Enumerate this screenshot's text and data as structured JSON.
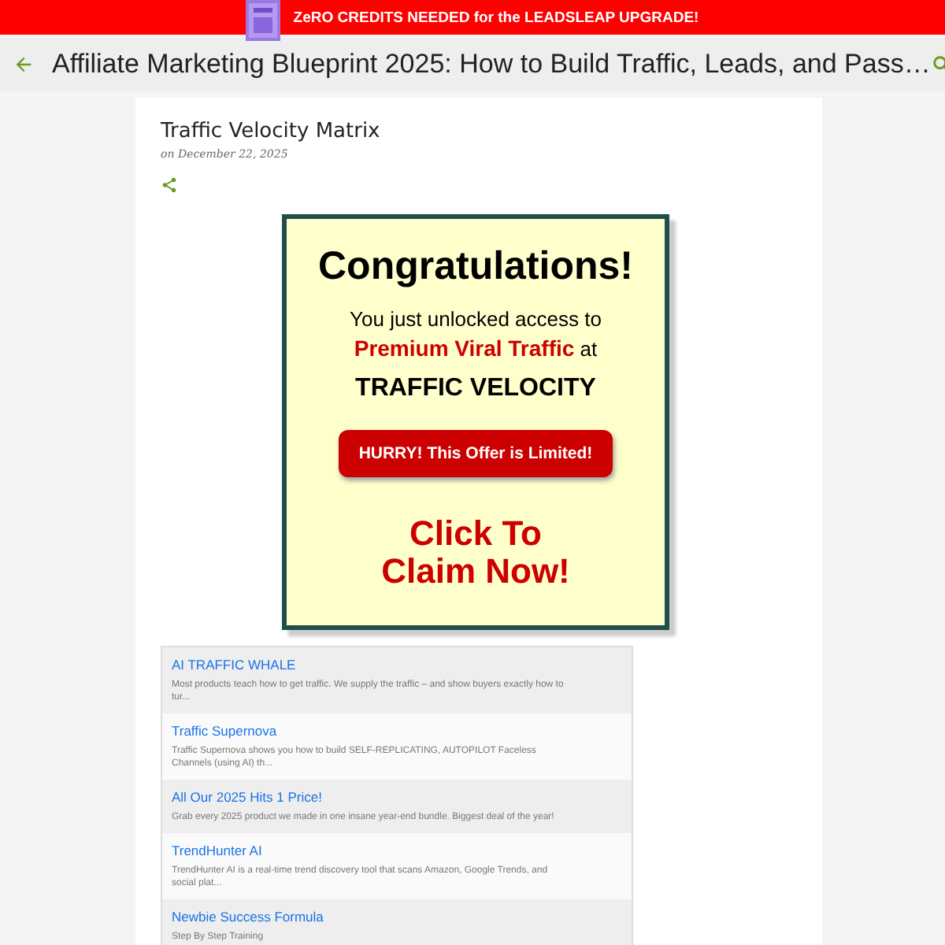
{
  "banner": {
    "text": "ZeRO CREDITS NEEDED for the LEADSLEAP UPGRADE!"
  },
  "header": {
    "title": "Affiliate Marketing Blueprint 2025: How to Build Traffic, Leads, and Pass…"
  },
  "post": {
    "title": "Traffic Velocity Matrix",
    "date": "on December 22, 2025"
  },
  "promo": {
    "heading": "Congratulations!",
    "line": "You just unlocked access to",
    "highlight": "Premium Viral Traffic",
    "suffix": "at",
    "product": "TRAFFIC VELOCITY",
    "button": "HURRY! This Offer is Limited!",
    "cta": [
      "Click To",
      "Claim Now!"
    ]
  },
  "offers": [
    {
      "title": "AI TRAFFIC WHALE",
      "text": "Most products teach how to get traffic. We supply the traffic – and show buyers exactly how to tur..."
    },
    {
      "title": "Traffic Supernova",
      "text": "Traffic Supernova shows you how to build SELF-REPLICATING, AUTOPILOT Faceless Channels (using AI) th..."
    },
    {
      "title": "All Our 2025 Hits 1 Price!",
      "text": "Grab every 2025 product we made in one insane year-end bundle. Biggest deal of the year!"
    },
    {
      "title": "TrendHunter AI",
      "text": "TrendHunter AI is a real-time trend discovery tool that scans Amazon, Google Trends, and social plat..."
    },
    {
      "title": "Newbie Success Formula",
      "text": "Step By Step Training"
    }
  ]
}
